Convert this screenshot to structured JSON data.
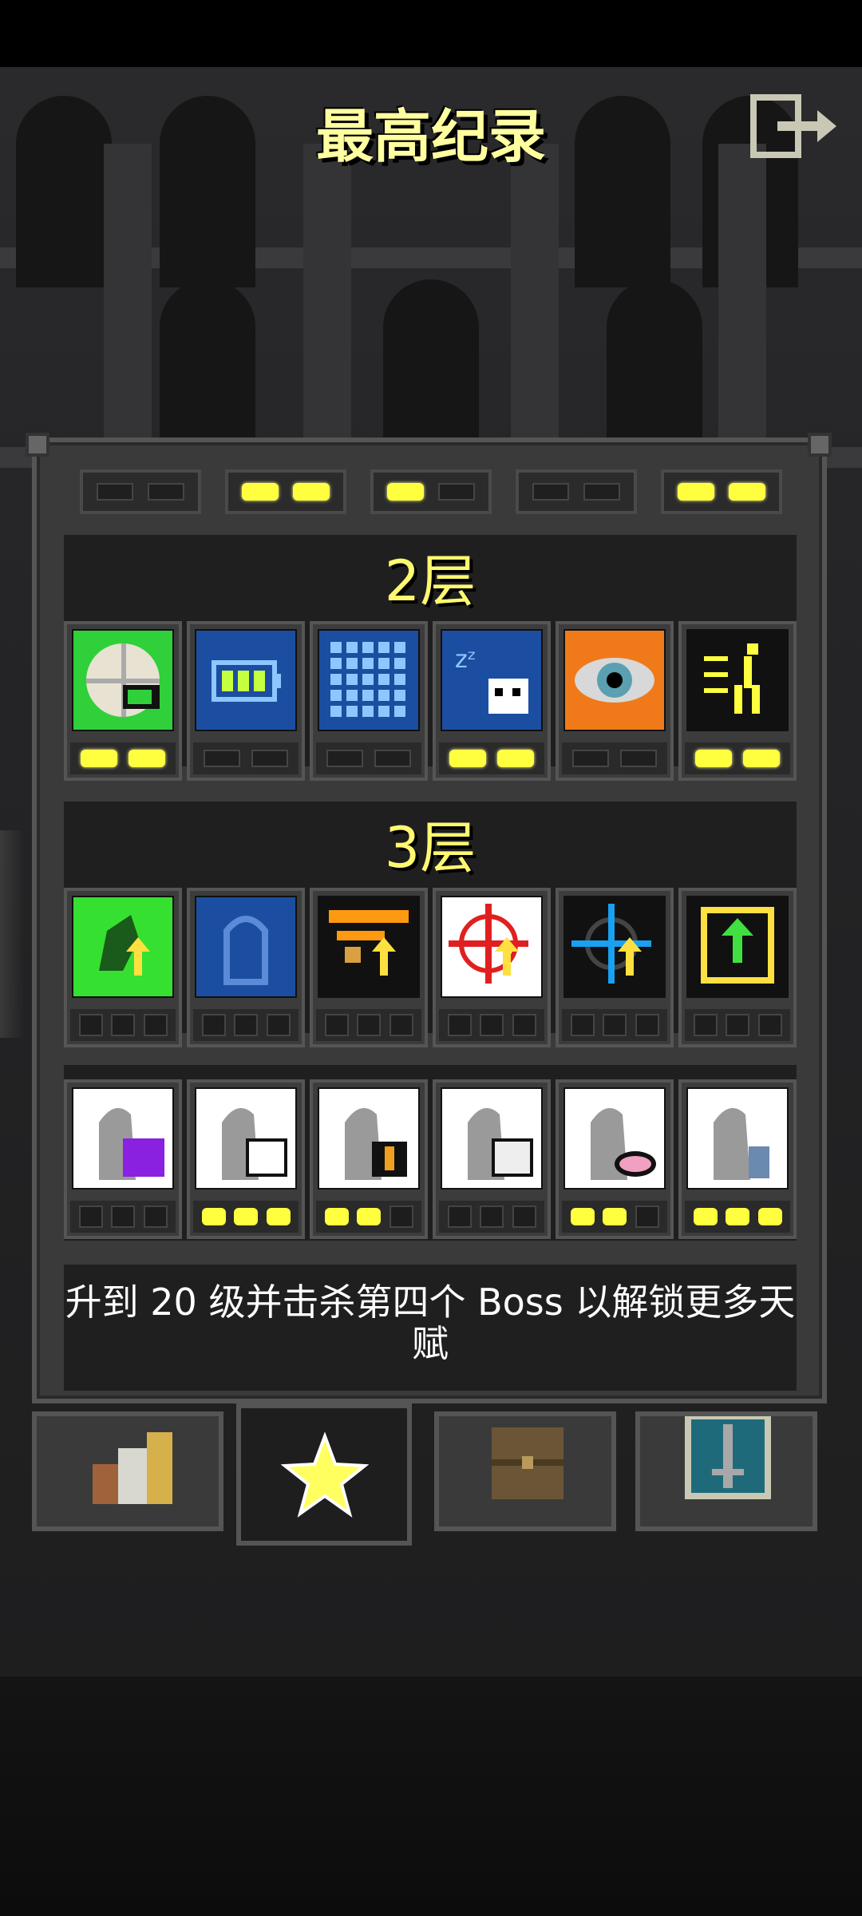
{
  "title": "最高纪录",
  "top_pips": [
    [
      false,
      false
    ],
    [
      true,
      true
    ],
    [
      true,
      false
    ],
    [
      false,
      false
    ],
    [
      true,
      true
    ]
  ],
  "tiers": [
    {
      "label": "2层",
      "cards": [
        {
          "icon": "green-shield-battery-icon",
          "bg": "#2fd03a",
          "pips": [
            true,
            true
          ]
        },
        {
          "icon": "battery-icon",
          "bg": "#1b4ea0",
          "pips": [
            false,
            false
          ]
        },
        {
          "icon": "grid-icon",
          "bg": "#1b4ea0",
          "pips": [
            false,
            false
          ]
        },
        {
          "icon": "sleeping-skull-icon",
          "bg": "#1b4ea0",
          "pips": [
            true,
            true
          ]
        },
        {
          "icon": "eye-icon",
          "bg": "#f07a1a",
          "pips": [
            false,
            false
          ]
        },
        {
          "icon": "running-figure-icon",
          "bg": "#111111",
          "pips": [
            true,
            true
          ]
        }
      ]
    },
    {
      "label": "3层",
      "cards": [
        {
          "icon": "green-hood-upgrade-icon",
          "bg": "#36e030",
          "pips": [
            false,
            false,
            false
          ]
        },
        {
          "icon": "blue-robe-icon",
          "bg": "#1b4ea0",
          "pips": [
            false,
            false,
            false
          ]
        },
        {
          "icon": "orange-banner-upgrade-icon",
          "bg": "#111111",
          "pips": [
            false,
            false,
            false
          ]
        },
        {
          "icon": "crosshair-upgrade-icon",
          "bg": "#ffffff",
          "pips": [
            false,
            false,
            false
          ]
        },
        {
          "icon": "blue-crosshair-upgrade-icon",
          "bg": "#111111",
          "pips": [
            false,
            false,
            false
          ]
        },
        {
          "icon": "scroll-upgrade-icon",
          "bg": "#111111",
          "pips": [
            false,
            false,
            false
          ]
        }
      ]
    },
    {
      "label": "",
      "cards": [
        {
          "icon": "silhouette-purple-skull-icon",
          "bg": "#ffffff",
          "pips": [
            false,
            false,
            false
          ]
        },
        {
          "icon": "silhouette-white-skull-icon",
          "bg": "#ffffff",
          "pips": [
            true,
            true,
            true
          ]
        },
        {
          "icon": "silhouette-runner-icon",
          "bg": "#ffffff",
          "pips": [
            true,
            true,
            false
          ]
        },
        {
          "icon": "silhouette-cracked-skull-icon",
          "bg": "#ffffff",
          "pips": [
            false,
            false,
            false
          ]
        },
        {
          "icon": "silhouette-pink-bag-icon",
          "bg": "#ffffff",
          "pips": [
            true,
            true,
            false
          ]
        },
        {
          "icon": "silhouette-blue-figure-icon",
          "bg": "#ffffff",
          "pips": [
            true,
            true,
            true
          ]
        }
      ]
    }
  ],
  "info_text": "升到 20 级并击杀第四个 Boss 以解锁更多天赋",
  "tabs": [
    {
      "icon": "books-icon",
      "active": false
    },
    {
      "icon": "star-icon",
      "active": true
    },
    {
      "icon": "chest-icon",
      "active": false
    },
    {
      "icon": "sword-badge-icon",
      "active": false
    }
  ],
  "colors": {
    "title": "#ffffa0",
    "tier_label": "#fff870",
    "pip_on": "#ffff40"
  }
}
